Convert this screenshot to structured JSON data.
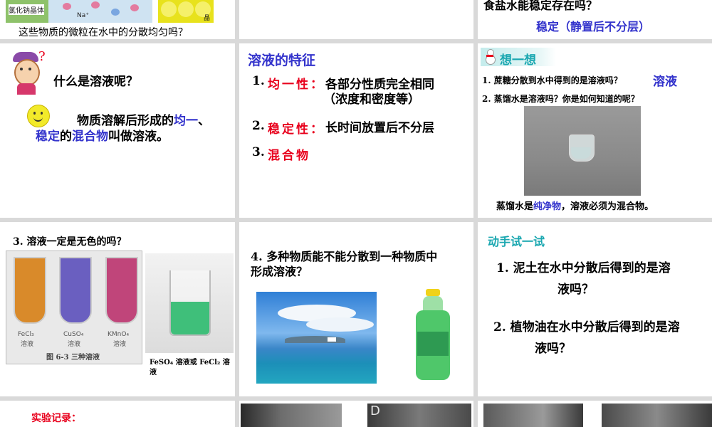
{
  "p1": {
    "img_label_1": "氯化钠晶体",
    "img_label_2": "Na⁺",
    "img_label_3": "晶",
    "caption": "这些物质的微粒在水中的分散均匀吗？"
  },
  "p3": {
    "question": "食盐水能稳定存在吗？",
    "answer": "稳定（静置后不分层）"
  },
  "p4": {
    "question": "什么是溶液呢？",
    "def_1": "物质溶解后形成的",
    "def_2": "均一",
    "def_3": "、",
    "def_4": "稳定",
    "def_5": "的",
    "def_6": "混合物",
    "def_7": "叫做溶液。"
  },
  "p5": {
    "title": "溶液的特征",
    "f1_num": "1.",
    "f1_name": "均一性：",
    "f1_desc": "各部分性质完全相同",
    "f1_sub": "（浓度和密度等）",
    "f2_num": "2.",
    "f2_name": "稳定性：",
    "f2_desc": "长时间放置后不分层",
    "f3_num": "3.",
    "f3_name": "混合物"
  },
  "p6": {
    "banner": "想一想",
    "q1": "1. 蔗糖分散到水中得到的是溶液吗？",
    "a1": "溶液",
    "q2": "2. 蒸馏水是溶液吗？你是如何知道的呢？",
    "caption_1": "蒸馏水是",
    "caption_2": "纯净物",
    "caption_3": "，溶液必须为混合物。"
  },
  "p7": {
    "question": "3. 溶液一定是无色的吗？",
    "tube_labels": [
      {
        "formula": "FeCl₃",
        "word": "溶液"
      },
      {
        "formula": "CuSO₄",
        "word": "溶液"
      },
      {
        "formula": "KMnO₄",
        "word": "溶液"
      }
    ],
    "figure_caption": "图 6-3  三种溶液",
    "beaker_caption_1": "FeSO₄ 溶液或 FeCl₂ 溶",
    "beaker_caption_2": "液",
    "colors": {
      "fecl3": "#d98a2a",
      "cuso4": "#6a5fc0",
      "kmno4": "#c0457a",
      "beaker": "#3fbf7a"
    }
  },
  "p8": {
    "question_1": "4. 多种物质能不能分散到一种物质中",
    "question_2": "形成溶液？"
  },
  "p9": {
    "title": "动手试一试",
    "q1_a": "1. 泥土在水中分散后得到的是溶",
    "q1_b": "液吗？",
    "q2_a": "2. 植物油在水中分散后得到的是溶",
    "q2_b": "液吗？"
  },
  "p10": {
    "label": "实验记录："
  },
  "p11": {
    "letter": "D"
  }
}
